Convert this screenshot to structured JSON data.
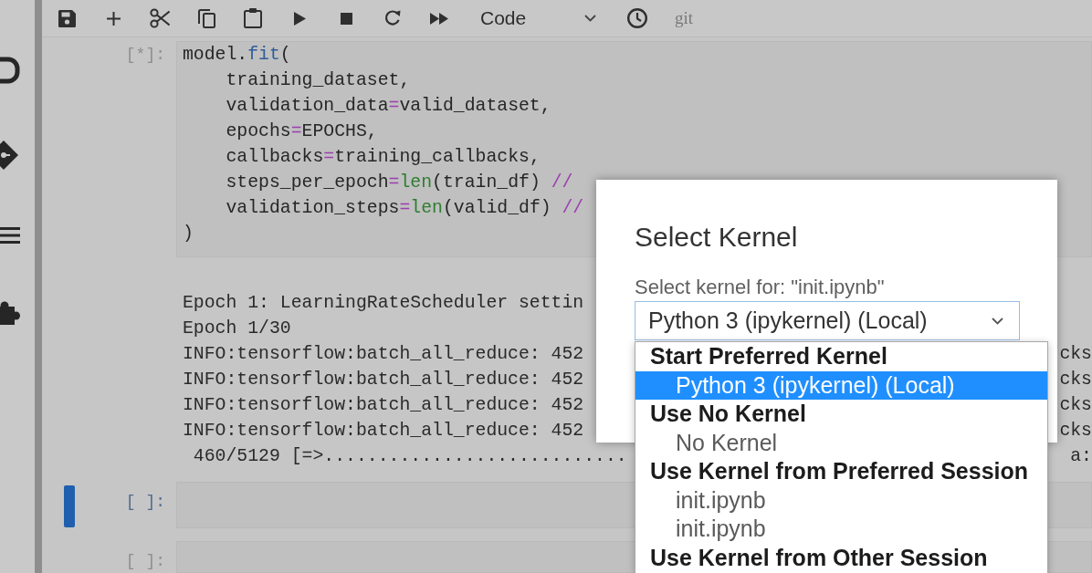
{
  "toolbar": {
    "cell_type": "Code",
    "git_label": "git"
  },
  "notebook": {
    "cells": [
      {
        "prompt": "[*]:",
        "selected": false,
        "code_lines": [
          [
            {
              "text": "model.",
              "kind": "plain"
            },
            {
              "text": "fit",
              "kind": "property"
            },
            {
              "text": "(",
              "kind": "plain"
            }
          ],
          [
            {
              "text": "    training_dataset,",
              "kind": "plain"
            }
          ],
          [
            {
              "text": "    validation_data",
              "kind": "plain"
            },
            {
              "text": "=",
              "kind": "operator"
            },
            {
              "text": "valid_dataset,",
              "kind": "plain"
            }
          ],
          [
            {
              "text": "    epochs",
              "kind": "plain"
            },
            {
              "text": "=",
              "kind": "operator"
            },
            {
              "text": "EPOCHS,",
              "kind": "plain"
            }
          ],
          [
            {
              "text": "    callbacks",
              "kind": "plain"
            },
            {
              "text": "=",
              "kind": "operator"
            },
            {
              "text": "training_callbacks,",
              "kind": "plain"
            }
          ],
          [
            {
              "text": "    steps_per_epoch",
              "kind": "plain"
            },
            {
              "text": "=",
              "kind": "operator"
            },
            {
              "text": "len",
              "kind": "builtin"
            },
            {
              "text": "(train_df) ",
              "kind": "plain"
            },
            {
              "text": "//",
              "kind": "operator"
            }
          ],
          [
            {
              "text": "    validation_steps",
              "kind": "plain"
            },
            {
              "text": "=",
              "kind": "operator"
            },
            {
              "text": "len",
              "kind": "builtin"
            },
            {
              "text": "(valid_df) ",
              "kind": "plain"
            },
            {
              "text": "//",
              "kind": "operator"
            }
          ],
          [
            {
              "text": ")",
              "kind": "plain"
            }
          ]
        ],
        "output_lines": [
          {
            "text": "Epoch 1: LearningRateScheduler settin"
          },
          {
            "text": "Epoch 1/30"
          },
          {
            "text": "INFO:tensorflow:batch_all_reduce: 452",
            "tail": "cks"
          },
          {
            "text": "INFO:tensorflow:batch_all_reduce: 452",
            "tail": "cks"
          },
          {
            "text": "INFO:tensorflow:batch_all_reduce: 452",
            "tail": "cks"
          },
          {
            "text": "INFO:tensorflow:batch_all_reduce: 452",
            "tail": "cks"
          },
          {
            "text": " 460/5129 [=>............................",
            "tail": "a:"
          }
        ]
      },
      {
        "prompt": "[ ]:",
        "selected": true
      },
      {
        "prompt": "[ ]:",
        "selected": false
      }
    ]
  },
  "dialog": {
    "title": "Select Kernel",
    "label": "Select kernel for: \"init.ipynb\"",
    "select_value": "Python 3 (ipykernel) (Local)",
    "options": [
      {
        "label": "Start Preferred Kernel",
        "children": [
          {
            "label": "Python 3 (ipykernel) (Local)",
            "selected": true
          }
        ]
      },
      {
        "label": "Use No Kernel",
        "children": [
          {
            "label": "No Kernel",
            "selected": false
          }
        ]
      },
      {
        "label": "Use Kernel from Preferred Session",
        "children": [
          {
            "label": "init.ipynb",
            "selected": false
          },
          {
            "label": "init.ipynb",
            "selected": false
          }
        ]
      },
      {
        "label": "Use Kernel from Other Session"
      }
    ]
  }
}
